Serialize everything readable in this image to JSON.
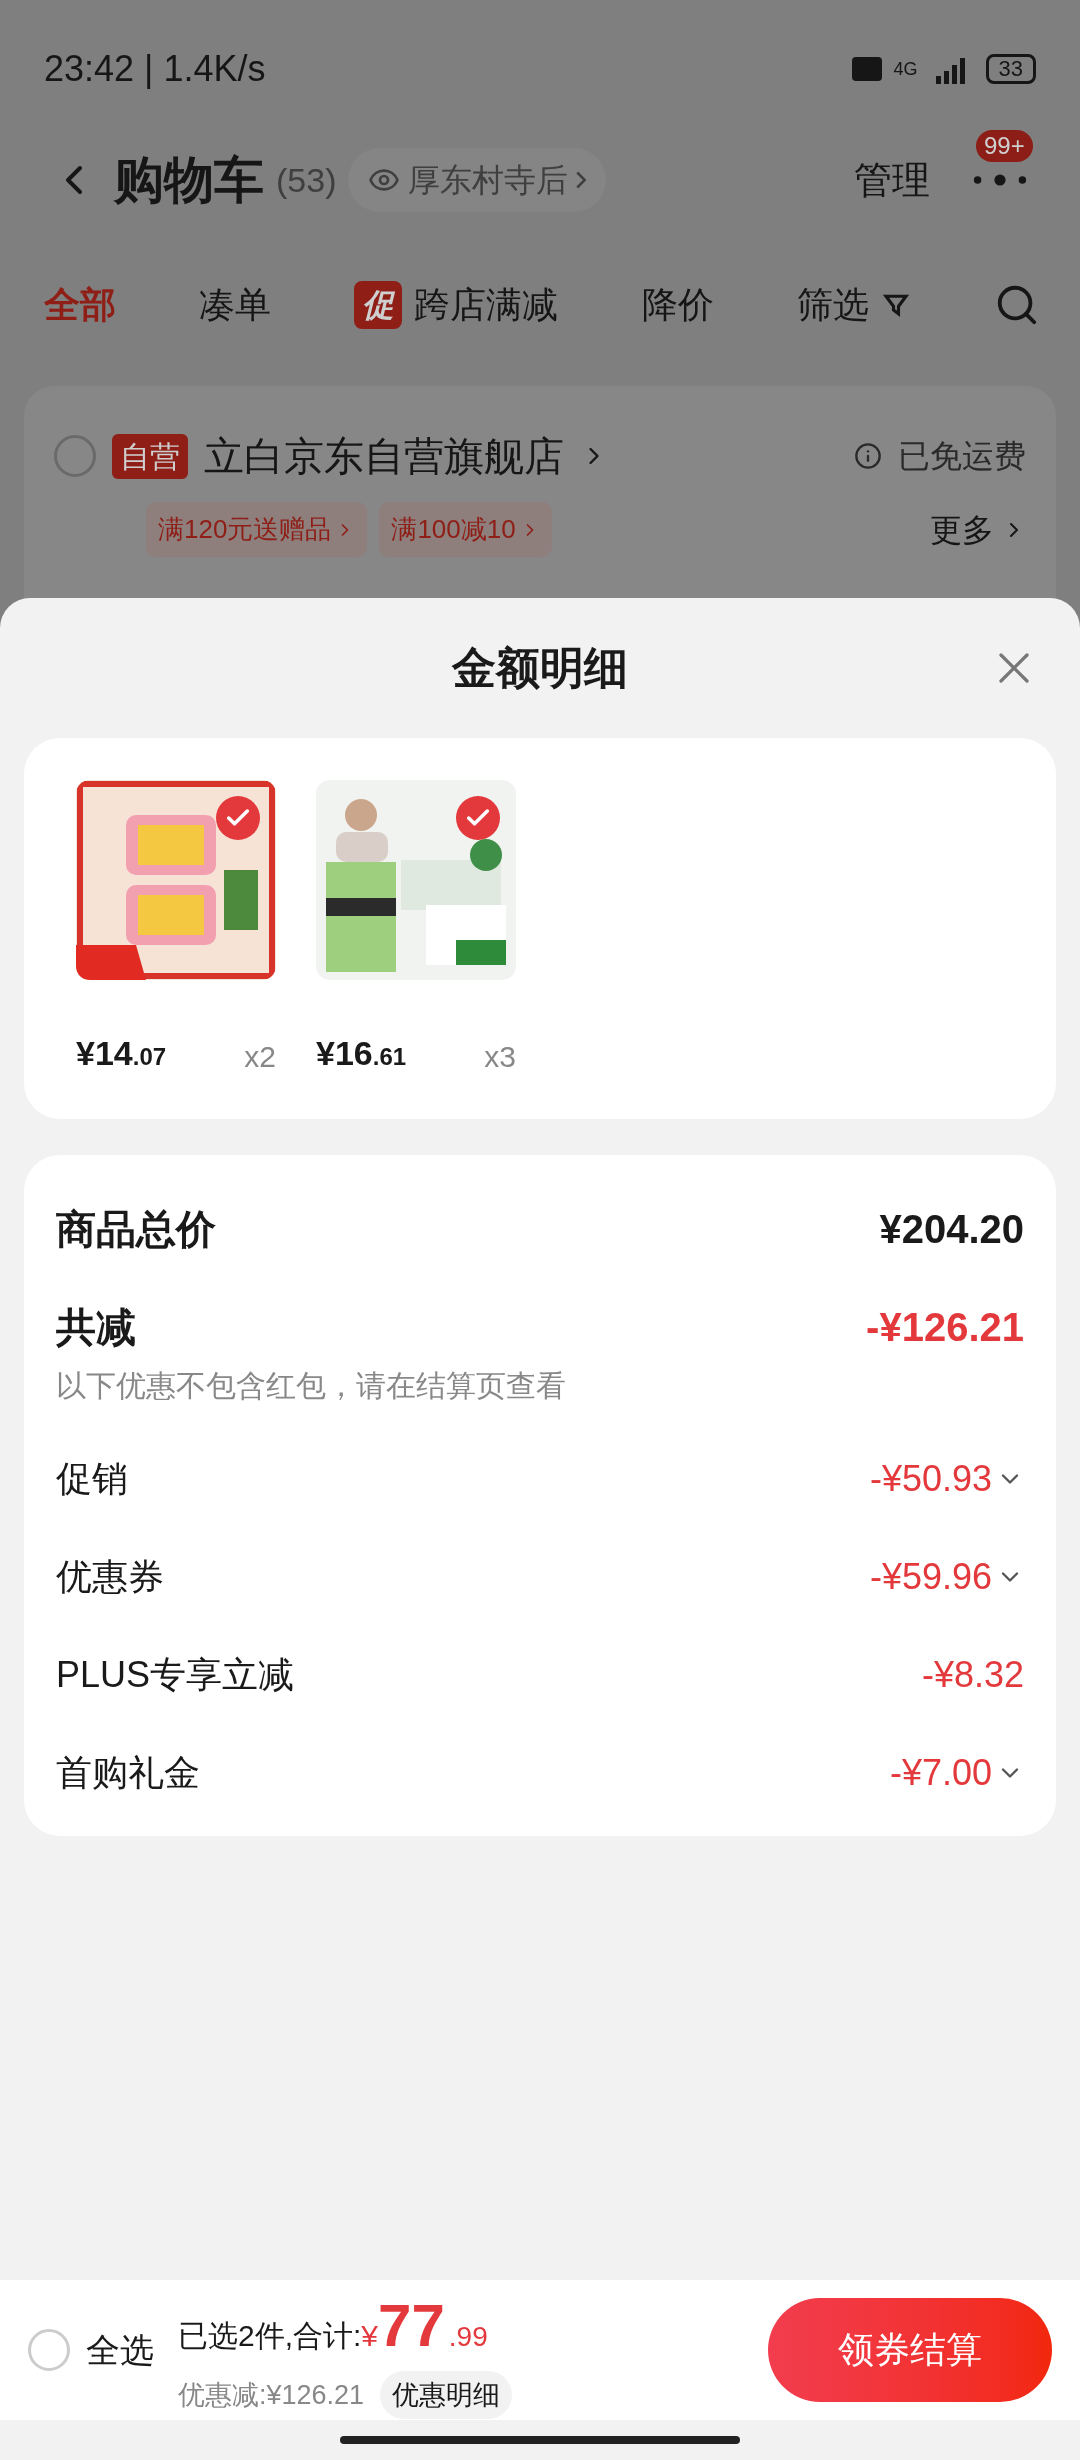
{
  "status_bar": {
    "time": "23:42 | 1.4K/s",
    "network": "4G",
    "battery": "33"
  },
  "header": {
    "title": "购物车",
    "count": "(53)",
    "location": "厚东村寺后",
    "manage": "管理",
    "badge": "99+"
  },
  "tabs": [
    {
      "label": "全部",
      "selected": true
    },
    {
      "label": "凑单",
      "selected": false
    },
    {
      "label": "跨店满减",
      "tag": "促",
      "selected": false
    },
    {
      "label": "降价",
      "selected": false
    },
    {
      "label": "筛选",
      "kind": "filter",
      "selected": false
    }
  ],
  "store": {
    "checked": false,
    "tag": "自营",
    "name": "立白京东自营旗舰店",
    "shipping": "已免运费",
    "promos": [
      "满120元送赠品",
      "满100减10"
    ],
    "more": "更多"
  },
  "sheet": {
    "title": "金额明细",
    "products": [
      {
        "price_int": "¥14",
        "price_dec": ".07",
        "qty": "x2",
        "selected": true,
        "kind": "pink"
      },
      {
        "price_int": "¥16",
        "price_dec": ".61",
        "qty": "x3",
        "selected": true,
        "kind": "green"
      }
    ],
    "total_label": "商品总价",
    "total": "¥204.20",
    "reduce_label": "共减",
    "reduce": "-¥126.21",
    "note": "以下优惠不包含红包，请在结算页查看",
    "items": [
      {
        "label": "促销",
        "amount": "-¥50.93",
        "expandable": true
      },
      {
        "label": "优惠券",
        "amount": "-¥59.96",
        "expandable": true
      },
      {
        "label": "PLUS专享立减",
        "amount": "-¥8.32",
        "expandable": false
      },
      {
        "label": "首购礼金",
        "amount": "-¥7.00",
        "expandable": true
      }
    ]
  },
  "bottom_bar": {
    "checked": false,
    "select_all": "全选",
    "selected_text": "已选2件,合计:",
    "currency": "¥",
    "total_int": "77",
    "total_dec": ".99",
    "discount": "优惠减:¥126.21",
    "detail_button": "优惠明细",
    "checkout": "领券结算"
  }
}
